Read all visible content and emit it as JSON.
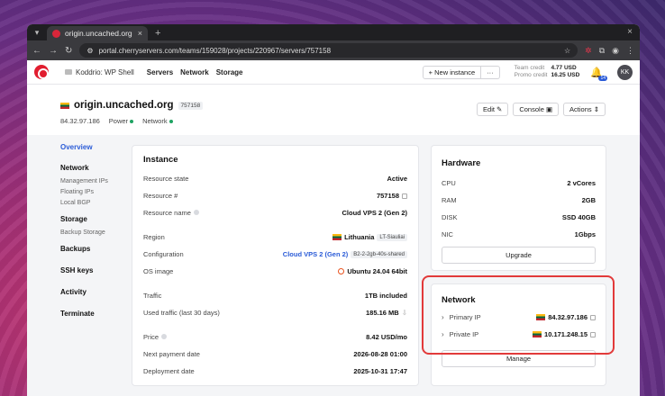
{
  "browser": {
    "tab_title": "origin.uncached.org (7…",
    "tab_close": "×",
    "newtab": "+",
    "url": "portal.cherryservers.com/teams/159028/projects/220967/servers/757158",
    "back": "←",
    "forward": "→",
    "reload": "↻",
    "win_close": "×"
  },
  "appbar": {
    "team": "Koddrio: WP Shell",
    "nav": [
      "Servers",
      "Network",
      "Storage"
    ],
    "new_instance": "+ New instance",
    "more": "···",
    "team_credit_label": "Team credit",
    "team_credit_value": "4.77 USD",
    "promo_credit_label": "Promo credit",
    "promo_credit_value": "16.25 USD",
    "notifications": "14",
    "avatar": "KK"
  },
  "server": {
    "name": "origin.uncached.org",
    "id": "757158",
    "ip": "84.32.97.186",
    "power_label": "Power",
    "network_label": "Network"
  },
  "actions": {
    "edit": "Edit ✎",
    "console": "Console ▣",
    "actions": "Actions ⇕"
  },
  "sidebar": {
    "overview": "Overview",
    "network": "Network",
    "network_sub": [
      "Management IPs",
      "Floating IPs",
      "Local BGP"
    ],
    "storage": "Storage",
    "storage_sub": [
      "Backup Storage"
    ],
    "backups": "Backups",
    "ssh": "SSH keys",
    "activity": "Activity",
    "terminate": "Terminate"
  },
  "instance": {
    "title": "Instance",
    "state_label": "Resource state",
    "state": "Active",
    "number_label": "Resource #",
    "number": "757158",
    "name_label": "Resource name",
    "name": "Cloud VPS 2 (Gen 2)",
    "region_label": "Region",
    "region": "Lithuania",
    "region_chip": "LT-Siauliai",
    "config_label": "Configuration",
    "config": "Cloud VPS 2 (Gen 2)",
    "config_chip": "B2-2-2gb-40s-shared",
    "os_label": "OS image",
    "os": "Ubuntu 24.04 64bit",
    "traffic_label": "Traffic",
    "traffic": "1TB included",
    "used_label": "Used traffic (last 30 days)",
    "used": "185.16 MB",
    "price_label": "Price",
    "price": "8.42 USD/mo",
    "next_label": "Next payment date",
    "next": "2026-08-28 01:00",
    "deploy_label": "Deployment date",
    "deploy": "2025-10-31 17:47"
  },
  "hardware": {
    "title": "Hardware",
    "rows": [
      {
        "label": "CPU",
        "value": "2 vCores"
      },
      {
        "label": "RAM",
        "value": "2GB"
      },
      {
        "label": "DISK",
        "value": "SSD 40GB"
      },
      {
        "label": "NIC",
        "value": "1Gbps"
      }
    ],
    "upgrade": "Upgrade"
  },
  "network": {
    "title": "Network",
    "primary_label": "Primary IP",
    "primary": "84.32.97.186",
    "private_label": "Private IP",
    "private": "10.171.248.15",
    "manage": "Manage"
  },
  "colors": {
    "accent": "#2a5bd7",
    "brand": "#e11d2f",
    "highlight": "#e23a3a",
    "status_ok": "#1ea362"
  }
}
